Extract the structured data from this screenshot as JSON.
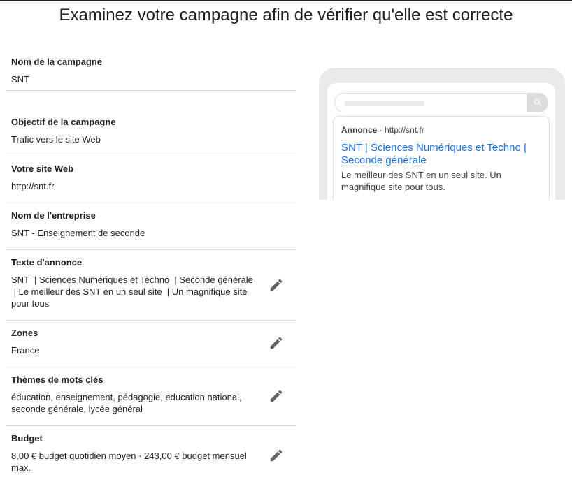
{
  "page": {
    "title": "Examinez votre campagne afin de vérifier qu'elle est correcte"
  },
  "summary": [
    {
      "label": "Nom de la campagne",
      "value": "SNT",
      "editable": false
    },
    {
      "label": "Objectif de la campagne",
      "value": "Trafic vers le site Web",
      "editable": false
    },
    {
      "label": "Votre site Web",
      "value": "http://snt.fr",
      "editable": false
    },
    {
      "label": "Nom de l'entreprise",
      "value": "SNT - Enseignement de seconde",
      "editable": false
    },
    {
      "label": "Texte d'annonce",
      "value_lines": [
        "SNT  | Sciences Numériques et Techno  | Seconde générale",
        " | Le meilleur des SNT en un seul site  | Un magnifique site",
        "pour tous"
      ],
      "editable": true
    },
    {
      "label": "Zones",
      "value": "France",
      "editable": true
    },
    {
      "label": "Thèmes de mots clés",
      "value_lines": [
        "éducation, enseignement, pédagogie, education national,",
        "seconde générale, lycée général"
      ],
      "editable": true
    },
    {
      "label": "Budget",
      "value_lines": [
        "8,00 € budget quotidien moyen · 243,00 € budget mensuel",
        "max."
      ],
      "editable": true
    }
  ],
  "preview": {
    "ad_label": "Annonce",
    "separator": "·",
    "display_url": "http://snt.fr",
    "headline_lines": [
      "SNT | Sciences Numériques et Techno |",
      "Seconde générale"
    ],
    "description_lines": [
      "Le meilleur des SNT en un seul site. Un",
      "magnifique site pour tous."
    ]
  },
  "icons": {
    "edit": "pencil-icon",
    "search": "search-icon"
  },
  "colors": {
    "link": "#1a73e8",
    "icon": "#5f6368",
    "divider": "#dadce0",
    "preview_frame": "#e8eaed"
  }
}
